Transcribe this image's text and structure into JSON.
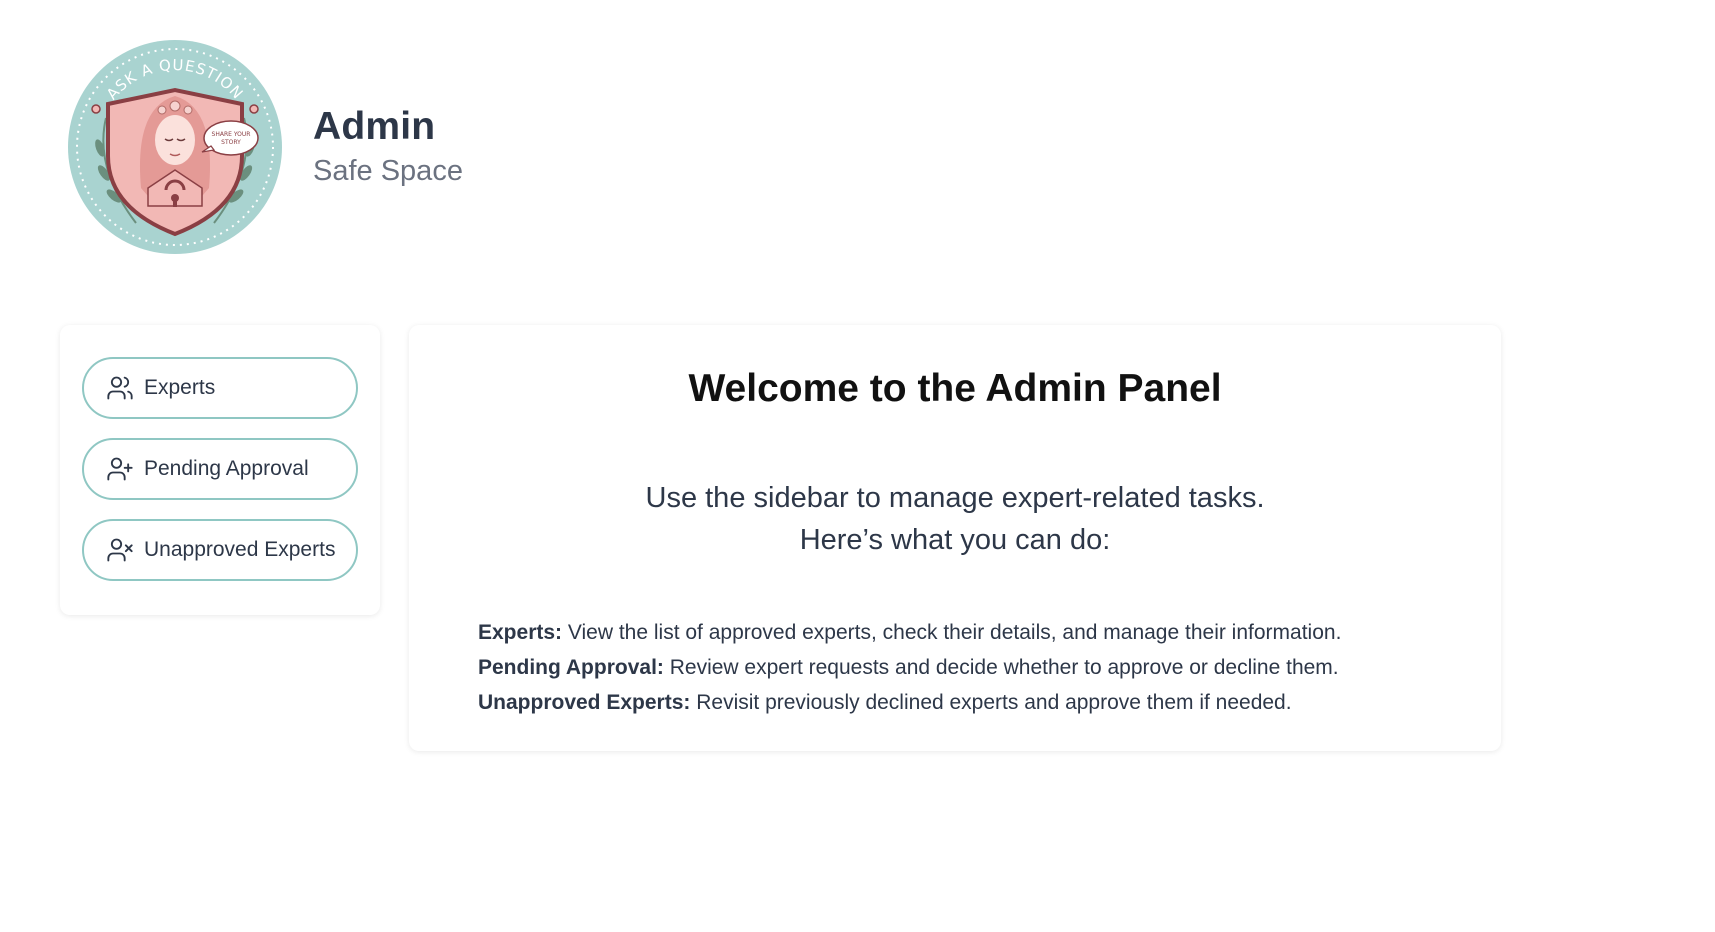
{
  "header": {
    "title": "Admin",
    "subtitle": "Safe Space",
    "logo": {
      "top_text": "ASK A QUESTION",
      "bubble_line1": "SHARE YOUR",
      "bubble_line2": "STORY"
    }
  },
  "sidebar": {
    "items": [
      {
        "label": "Experts",
        "icon": "users-icon"
      },
      {
        "label": "Pending Approval",
        "icon": "user-plus-icon"
      },
      {
        "label": "Unapproved Experts",
        "icon": "user-x-icon"
      }
    ]
  },
  "main": {
    "title": "Welcome to the Admin Panel",
    "intro_line1": "Use the sidebar to manage expert-related tasks.",
    "intro_line2": "Here’s what you can do:",
    "features": [
      {
        "term": "Experts:",
        "desc": " View the list of approved experts, check their details, and manage their information."
      },
      {
        "term": "Pending Approval:",
        "desc": " Review expert requests and decide whether to approve or decline them."
      },
      {
        "term": "Unapproved Experts:",
        "desc": " Revisit previously declined experts and approve them if needed."
      }
    ]
  },
  "colors": {
    "accent_border": "#8fc7c3",
    "logo_background": "#a9d3d0",
    "shield": "#f2b8b5",
    "text_dark": "#2d3748",
    "text_muted": "#6b7280"
  }
}
